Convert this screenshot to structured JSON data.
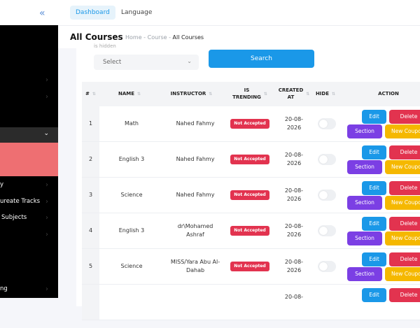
{
  "sidebar": {
    "items": [
      {
        "label": "y"
      },
      {
        "label": "ureate Tracks"
      },
      {
        "label": "Subjects"
      },
      {
        "label": "ng"
      }
    ]
  },
  "topbar": {
    "tabs": [
      {
        "label": "Dashboard",
        "active": true
      },
      {
        "label": "Language",
        "active": false
      }
    ]
  },
  "page": {
    "title": "All Courses",
    "breadcrumb": {
      "home": "Home",
      "sep": "-",
      "course": "Course",
      "current": "All Courses"
    }
  },
  "filter": {
    "cut_label": "is hidden",
    "select_value": "Select",
    "search_label": "Search"
  },
  "table": {
    "headers": {
      "index": "#",
      "name": "NAME",
      "instructor": "INSTRUCTOR",
      "is_trending_1": "IS",
      "is_trending_2": "TRENDING",
      "created_1": "CREATED",
      "created_2": "AT",
      "hide": "HIDE",
      "action": "ACTION"
    },
    "rows": [
      {
        "index": "1",
        "name": "Math",
        "instructor_1": "Nahed Fahmy",
        "instructor_2": "",
        "trending": "Not Accepted",
        "date_1": "20-08-",
        "date_2": "2026",
        "hidden": false
      },
      {
        "index": "2",
        "name": "English 3",
        "instructor_1": "Nahed Fahmy",
        "instructor_2": "",
        "trending": "Not Accepted",
        "date_1": "20-08-",
        "date_2": "2026",
        "hidden": false
      },
      {
        "index": "3",
        "name": "Science",
        "instructor_1": "Nahed Fahmy",
        "instructor_2": "",
        "trending": "Not Accepted",
        "date_1": "20-08-",
        "date_2": "2026",
        "hidden": false
      },
      {
        "index": "4",
        "name": "English 3",
        "instructor_1": "dr\\Mohamed",
        "instructor_2": "Ashraf",
        "trending": "Not Accepted",
        "date_1": "20-08-",
        "date_2": "2026",
        "hidden": false
      },
      {
        "index": "5",
        "name": "Science",
        "instructor_1": "MISS/Yara Abu Al-",
        "instructor_2": "Dahab",
        "trending": "Not Accepted",
        "date_1": "20-08-",
        "date_2": "2026",
        "hidden": false
      },
      {
        "index": "",
        "name": "",
        "instructor_1": "",
        "instructor_2": "",
        "trending": "",
        "date_1": "20-08-",
        "date_2": "",
        "hidden": false
      }
    ],
    "actions": {
      "edit": "Edit",
      "delete": "Delete",
      "section": "Section",
      "new_coupon": "New Coupo"
    }
  },
  "colors": {
    "accent": "#1a98e8",
    "danger": "#e2334f",
    "purple": "#7b3fe4",
    "yellow": "#f5b800",
    "sidebar_active": "#ee6f72"
  }
}
